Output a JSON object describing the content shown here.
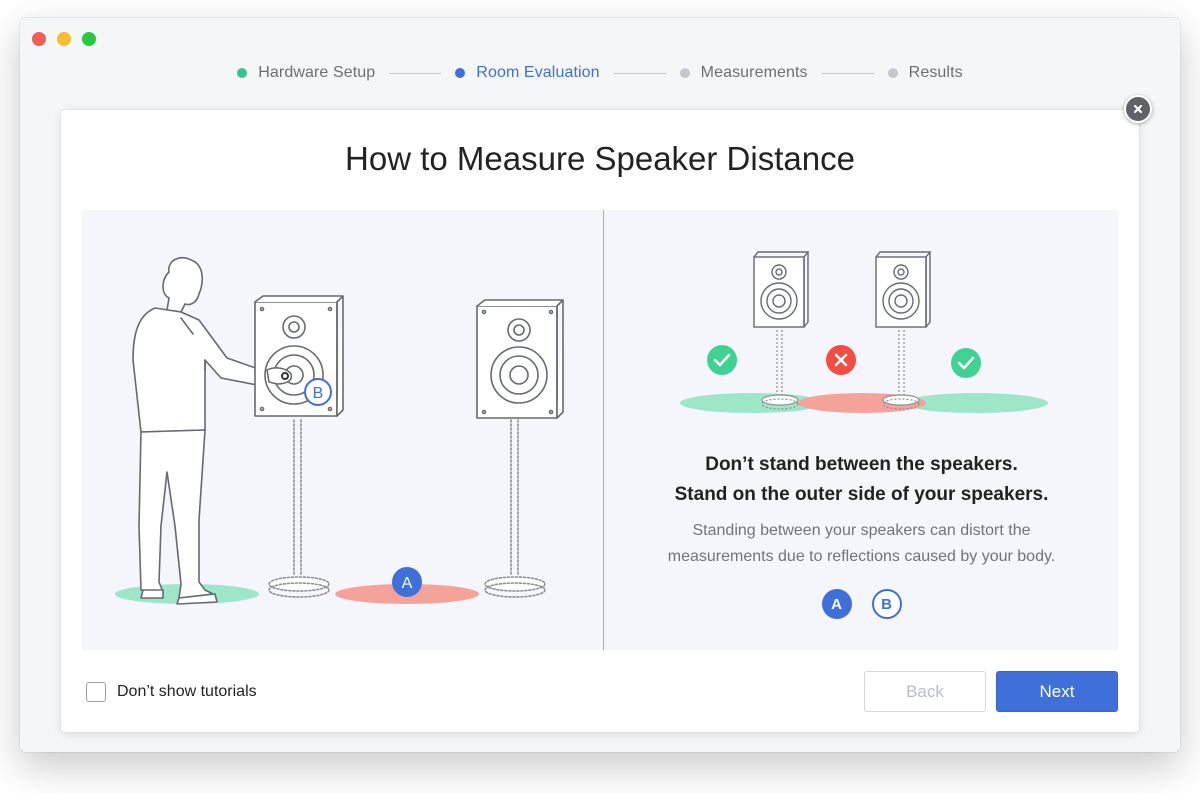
{
  "window": {
    "traffic_lights": [
      {
        "name": "close",
        "color": "#ed5f57"
      },
      {
        "name": "minimize",
        "color": "#f5bd2f"
      },
      {
        "name": "zoom",
        "color": "#28c840"
      }
    ]
  },
  "stepper": {
    "steps": [
      {
        "label": "Hardware Setup",
        "state": "complete",
        "dot_color": "#34c38f"
      },
      {
        "label": "Room Evaluation",
        "state": "active",
        "dot_color": "#3f6fd8"
      },
      {
        "label": "Measurements",
        "state": "pending",
        "dot_color": "#c5c8cd"
      },
      {
        "label": "Results",
        "state": "pending",
        "dot_color": "#c5c8cd"
      }
    ]
  },
  "dialog": {
    "title": "How to Measure Speaker Distance",
    "close_icon": "close-icon",
    "left_illustration": {
      "marker_a": "A",
      "marker_b": "B"
    },
    "right_illustration": {
      "indicators": [
        "check-icon",
        "cross-icon",
        "check-icon"
      ]
    },
    "tip_title_line1": "Don’t stand between the speakers.",
    "tip_title_line2": "Stand on the outer side of your speakers.",
    "tip_desc_line1": "Standing between your speakers can distort the",
    "tip_desc_line2": "measurements due to reflections caused by your body.",
    "badge_a": "A",
    "badge_b": "B",
    "dont_show_label": "Don’t show tutorials",
    "back_label": "Back",
    "next_label": "Next"
  },
  "colors": {
    "accent": "#3f6fd8",
    "good_zone": "#9ee6c8",
    "bad_zone": "#f5a39a",
    "check_green": "#40d293",
    "cross_red": "#f24d40"
  }
}
